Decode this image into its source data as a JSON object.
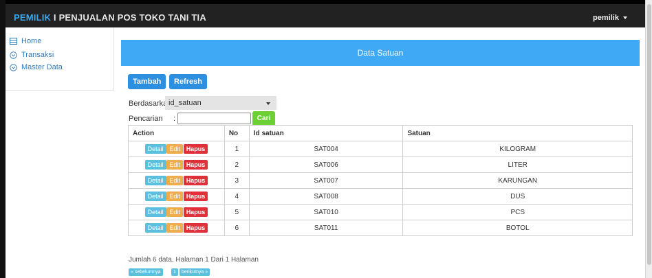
{
  "header": {
    "brand_role": "PEMILIK",
    "brand_sep": " I ",
    "brand_title": "PENJUALAN POS TOKO TANI TIA",
    "user_menu": "pemilik"
  },
  "sidebar": {
    "items": [
      {
        "label": "Home",
        "icon": "table-icon"
      },
      {
        "label": "Transaksi",
        "icon": "chevron-circle-icon"
      },
      {
        "label": "Master Data",
        "icon": "chevron-circle-icon"
      }
    ]
  },
  "panel": {
    "title": "Data Satuan",
    "add_button": "Tambah",
    "refresh_button": "Refresh",
    "filter_label": "Berdasarkan:",
    "filter_value": "id_satuan",
    "search_label": "Pencarian",
    "search_value": "",
    "search_button": "Cari"
  },
  "table": {
    "headers": [
      "Action",
      "No",
      "Id satuan",
      "Satuan"
    ],
    "action_labels": {
      "detail": "Detail",
      "edit": "Edit",
      "hapus": "Hapus"
    },
    "rows": [
      {
        "no": "1",
        "id": "SAT004",
        "satuan": "KILOGRAM"
      },
      {
        "no": "2",
        "id": "SAT006",
        "satuan": "LITER"
      },
      {
        "no": "3",
        "id": "SAT007",
        "satuan": "KARUNGAN"
      },
      {
        "no": "4",
        "id": "SAT008",
        "satuan": "DUS"
      },
      {
        "no": "5",
        "id": "SAT010",
        "satuan": "PCS"
      },
      {
        "no": "6",
        "id": "SAT011",
        "satuan": "BOTOL"
      }
    ]
  },
  "footer": {
    "summary": "Jumlah 6 data, Halaman 1 Dari 1 Halaman",
    "prev": "« sebelumnya",
    "page": "1",
    "next": "berikutnya »"
  },
  "colors": {
    "topbar": "#222222",
    "panel_header": "#3fa9f5",
    "primary_button": "#2d8fe0",
    "search_button": "#6ccf34",
    "detail": "#5bc0de",
    "edit": "#f0ad4e",
    "hapus": "#e0303a"
  }
}
